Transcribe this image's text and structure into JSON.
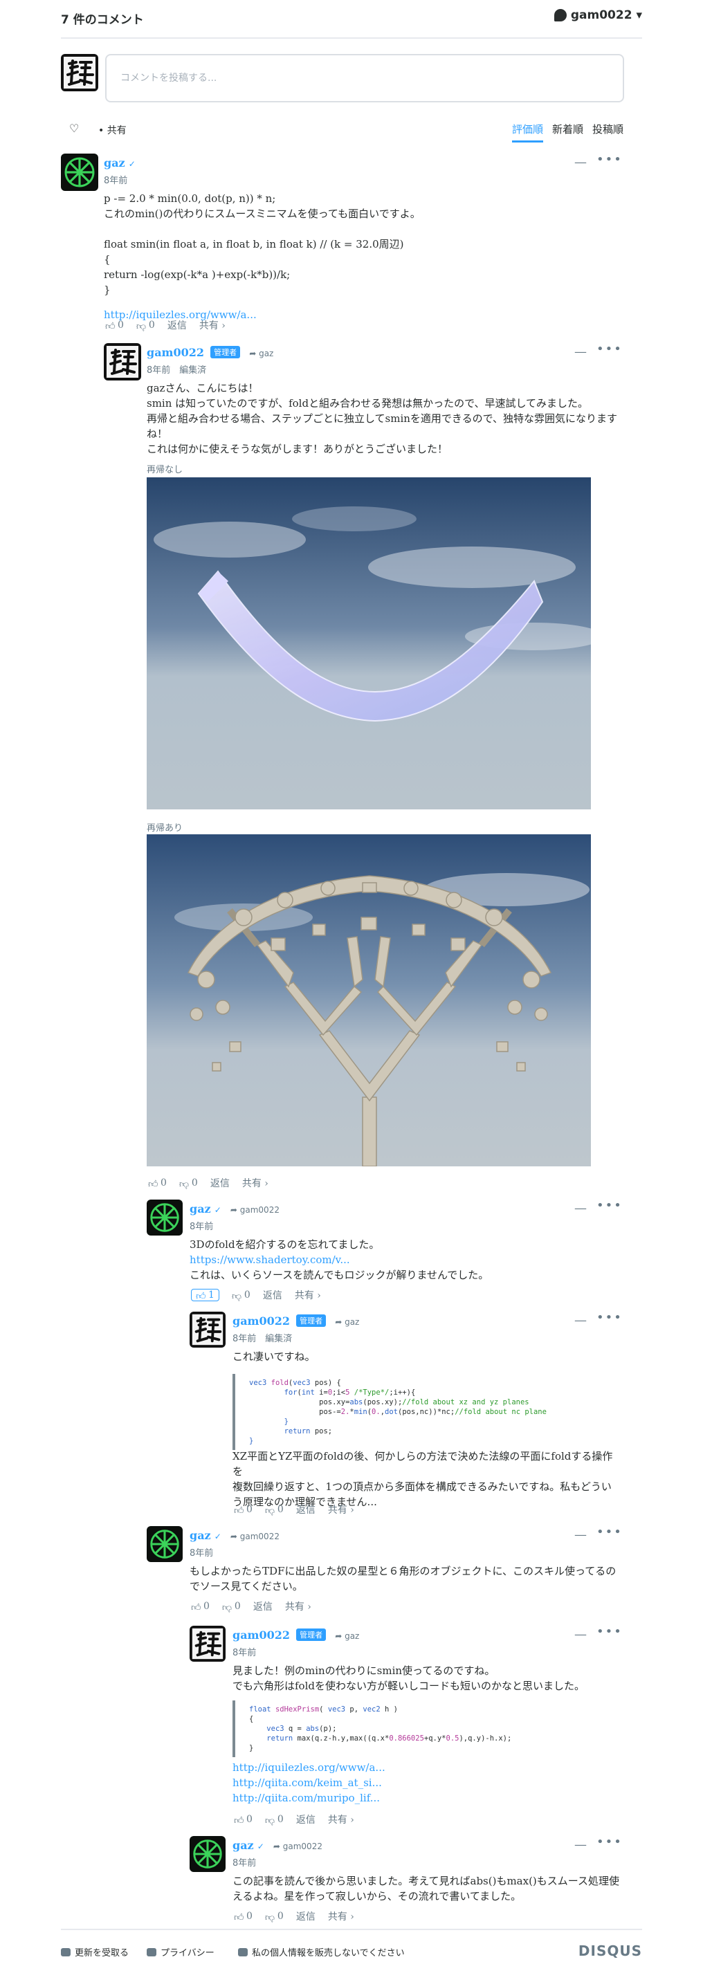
{
  "header": {
    "comment_count": "7 件のコメント",
    "user": "gam0022 ▾"
  },
  "compose": {
    "placeholder": "コメントを投稿する..."
  },
  "sortbar": {
    "like_icon": "heart-icon",
    "share": "• 共有",
    "tabs": [
      "評価順",
      "新着順",
      "投稿順"
    ],
    "active_tab": 0
  },
  "comments": {
    "c1": {
      "author": "gaz",
      "time": "8年前",
      "lines": [
        "p -= 2.0 * min(0.0, dot(p, n)) * n;",
        "これのmin()の代わりにスムースミニマムを使っても面白いですよ。",
        "",
        "float smin(in float a, in float b, in float k) // (k = 32.0周辺)",
        "{",
        "return -log(exp(-k*a )+exp(-k*b))/k;",
        "}"
      ],
      "link": "http://iquilezles.org/www/a...",
      "up": "0",
      "down": "0",
      "reply": "返信",
      "share": "共有 ›"
    },
    "c2": {
      "author": "gam0022",
      "badge": "管理者",
      "reply_to": "gaz",
      "time": "8年前",
      "edited": "編集済",
      "lines": [
        "gazさん、こんにちは！",
        "smin は知っていたのですが、foldと組み合わせる発想は無かったので、早速試してみました。",
        "再帰と組み合わせる場合、ステップごとに独立してsminを適用できるので、独特な雰囲気になります",
        "ね！",
        "これは何かに使えそうな気がします！ありがとうございました！"
      ],
      "label_a": "再帰なし",
      "label_b": "再帰あり",
      "up": "0",
      "down": "0",
      "reply": "返信",
      "share": "共有 ›"
    },
    "c3": {
      "author": "gaz",
      "reply_to": "gam0022",
      "time": "8年前",
      "lines": [
        "3Dのfoldを紹介するのを忘れてました。"
      ],
      "link": "https://www.shadertoy.com/v...",
      "after": "これは、いくらソースを読んでもロジックが解りませんでした。",
      "up": "1",
      "down": "0",
      "reply": "返信",
      "share": "共有 ›"
    },
    "c4": {
      "author": "gam0022",
      "badge": "管理者",
      "reply_to": "gaz",
      "time": "8年前",
      "edited": "編集済",
      "intro": "これ凄いですね。",
      "code": [
        "vec3 fold(vec3 pos) {",
        "    for(int i=0;i<5 /*Type*/;i++){",
        "        pos.xy=abs(pos.xy);//fold about xz and yz planes",
        "        pos-=2.*min(0.,dot(pos,nc))*nc;//fold about nc plane",
        "    }",
        "    return pos;",
        "}"
      ],
      "lines": [
        "XZ平面とYZ平面のfoldの後、何かしらの方法で決めた法線の平面にfoldする操作を",
        "複数回繰り返すと、1つの頂点から多面体を構成できるみたいですね。私もどうい",
        "う原理なのか理解できません..."
      ],
      "up": "0",
      "down": "0",
      "reply": "返信",
      "share": "共有 ›"
    },
    "c5": {
      "author": "gaz",
      "reply_to": "gam0022",
      "time": "8年前",
      "lines": [
        "もしよかったらTDFに出品した奴の星型と６角形のオブジェクトに、このスキル使ってるの",
        "でソース見てください。"
      ],
      "up": "0",
      "down": "0",
      "reply": "返信",
      "share": "共有 ›"
    },
    "c6": {
      "author": "gam0022",
      "badge": "管理者",
      "reply_to": "gaz",
      "time": "8年前",
      "lines": [
        "見ました！例のminの代わりにsmin使ってるのですね。",
        "でも六角形はfoldを使わない方が軽いしコードも短いのかなと思いました。"
      ],
      "code": [
        "float sdHexPrism( vec3 p, vec2 h )",
        "{",
        "    vec3 q = abs(p);",
        "    return max(q.z-h.y,max((q.x*0.866025+q.y*0.5),q.y)-h.x);",
        "}"
      ],
      "links": [
        "http://iquilezles.org/www/a...",
        "http://qiita.com/keim_at_si...",
        "http://qiita.com/muripo_lif..."
      ],
      "up": "0",
      "down": "0",
      "reply": "返信",
      "share": "共有 ›"
    },
    "c7": {
      "author": "gaz",
      "reply_to": "gam0022",
      "time": "8年前",
      "lines": [
        "この記事を読んで後から思いました。考えて見ればabs()もmax()もスムース処理使",
        "えるよね。星を作って寂しいから、その流れで書いてました。"
      ],
      "up": "0",
      "down": "0",
      "reply": "返信",
      "share": "共有 ›"
    }
  },
  "footer": {
    "subscribe": "更新を受取る",
    "privacy": "プライバシー",
    "donotsell": "私の個人情報を販売しないでください",
    "brand": "DISQUS"
  },
  "colors": {
    "accent": "#2e9fff",
    "text": "#2a2e2e",
    "muted": "#687a86"
  }
}
